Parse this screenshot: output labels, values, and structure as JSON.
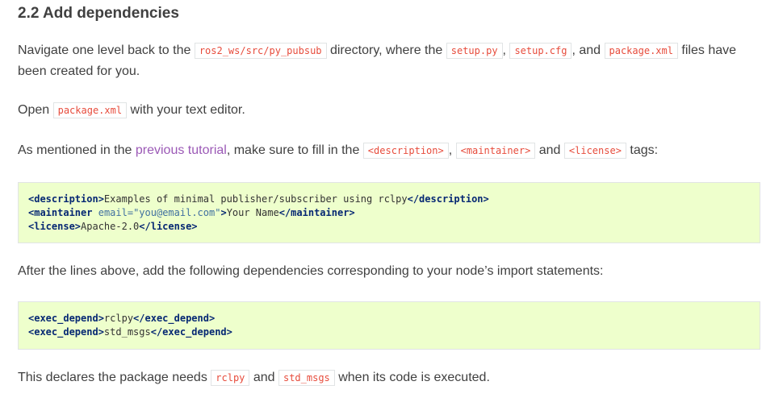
{
  "heading": "2.2 Add dependencies",
  "p1": {
    "t1": "Navigate one level back to the ",
    "c1": "ros2_ws/src/py_pubsub",
    "t2": " directory, where the ",
    "c2": "setup.py",
    "t3": ", ",
    "c3": "setup.cfg",
    "t4": ", and ",
    "c4": "package.xml",
    "t5": " files have been created for you."
  },
  "p2": {
    "t1": "Open ",
    "c1": "package.xml",
    "t2": " with your text editor."
  },
  "p3": {
    "t1": "As mentioned in the ",
    "link": "previous tutorial",
    "t2": ", make sure to fill in the ",
    "c1": "<description>",
    "t3": ", ",
    "c2": "<maintainer>",
    "t4": " and ",
    "c3": "<license>",
    "t5": " tags:"
  },
  "code1": {
    "l1_open": "<description>",
    "l1_text": "Examples of minimal publisher/subscriber using rclpy",
    "l1_close": "</description>",
    "l2_open": "<maintainer",
    "l2_attr": "email=",
    "l2_val": "\"you@email.com\"",
    "l2_gt": ">",
    "l2_text": "Your Name",
    "l2_close": "</maintainer>",
    "l3_open": "<license>",
    "l3_text": "Apache-2.0",
    "l3_close": "</license>"
  },
  "p4": {
    "t1": "After the lines above, add the following dependencies corresponding to your node’s import statements:"
  },
  "code2": {
    "l1_open": "<exec_depend>",
    "l1_text": "rclpy",
    "l1_close": "</exec_depend>",
    "l2_open": "<exec_depend>",
    "l2_text": "std_msgs",
    "l2_close": "</exec_depend>"
  },
  "p5": {
    "t1": "This declares the package needs ",
    "c1": "rclpy",
    "t2": " and ",
    "c2": "std_msgs",
    "t3": " when its code is executed."
  },
  "colors": {
    "text": "#404040",
    "inline_code": "#e74c3c",
    "link": "#9b59b6",
    "code_bg": "#eeffcc",
    "xml_tag": "#062873"
  }
}
